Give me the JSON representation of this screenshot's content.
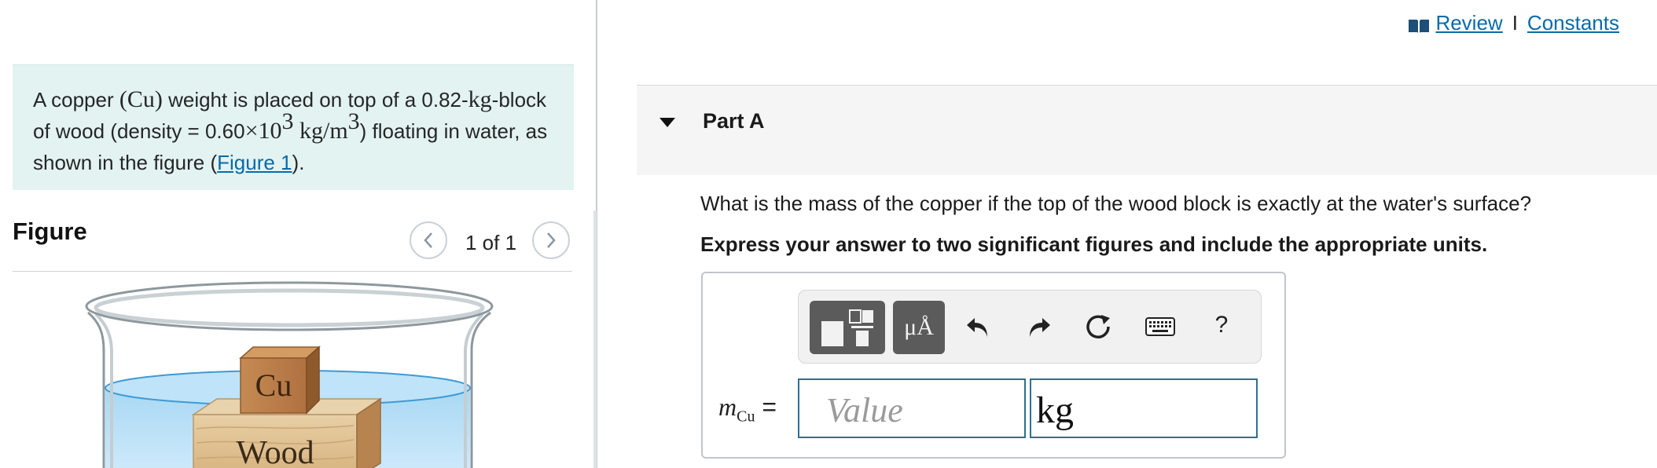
{
  "problem": {
    "text_1": "A copper ",
    "cu_symbol": "(Cu)",
    "text_2": " weight is placed on top of a 0.82-",
    "kg_unit": "kg",
    "text_3": "-block of wood (density = 0.60",
    "times": "×",
    "ten": "10",
    "exp_3": "3",
    "density_unit": " kg/m",
    "exp_3b": "3",
    "text_4": ") floating in water, as shown in the figure (",
    "figure_link": "Figure 1",
    "text_5": ")."
  },
  "figure": {
    "title": "Figure",
    "counter": "1 of 1",
    "copper_label": "Cu",
    "wood_label": "Wood"
  },
  "header_links": {
    "review": "Review",
    "separator": "I",
    "constants": "Constants"
  },
  "part": {
    "title": "Part A",
    "question": "What is the mass of the copper if the top of the wood block is exactly at the water's surface?",
    "instruction": "Express your answer to two significant figures and include the appropriate units."
  },
  "toolbar": {
    "symbols_label": "μÅ",
    "help_label": "?"
  },
  "answer": {
    "var": "m",
    "sub": "Cu",
    "equals": " =",
    "value_placeholder": "Value",
    "units_value": "kg"
  },
  "colors": {
    "link": "#0b6aa8",
    "problem_bg": "#e2f3f1",
    "input_border": "#2d6f95",
    "toolbar_dark": "#5b5b5b"
  }
}
